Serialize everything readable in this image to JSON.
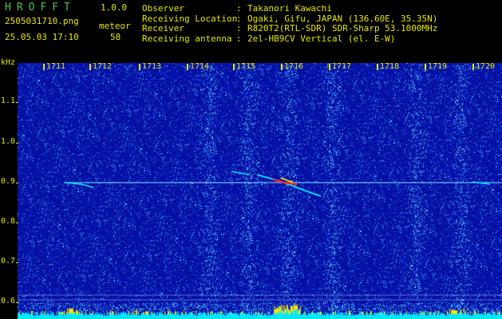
{
  "header": {
    "app_title": "HROFFT",
    "app_version": "1.0.0",
    "filename": "2505031710.png",
    "mode": "meteor",
    "datetime": "25.05.03 17:10",
    "count": "58"
  },
  "station_info": [
    {
      "key": "Observer",
      "value": "Takanori Kawachi"
    },
    {
      "key": "Receiving Location",
      "value": "Ogaki, Gifu, JAPAN (136.60E, 35.35N)"
    },
    {
      "key": "Receiver",
      "value": "R820T2(RTL-SDR) SDR-Sharp 53.1000MHz"
    },
    {
      "key": "Receiving antenna",
      "value": "2el-HB9CV Vertical (el. E-W)"
    }
  ],
  "axes": {
    "y_unit": "kHz",
    "x_ticks": [
      "1711",
      "1712",
      "1713",
      "1714",
      "1715",
      "1716",
      "1717",
      "1718",
      "1719",
      "1720"
    ],
    "y_ticks": [
      "1.1",
      "1.0",
      "0.9",
      "0.8",
      "0.7",
      "0.6"
    ]
  },
  "colors": {
    "background": "#06109a",
    "text": "#e6e600",
    "title": "#4ec24e",
    "signal": "#00e0ff",
    "hot": "#ff2020"
  }
}
